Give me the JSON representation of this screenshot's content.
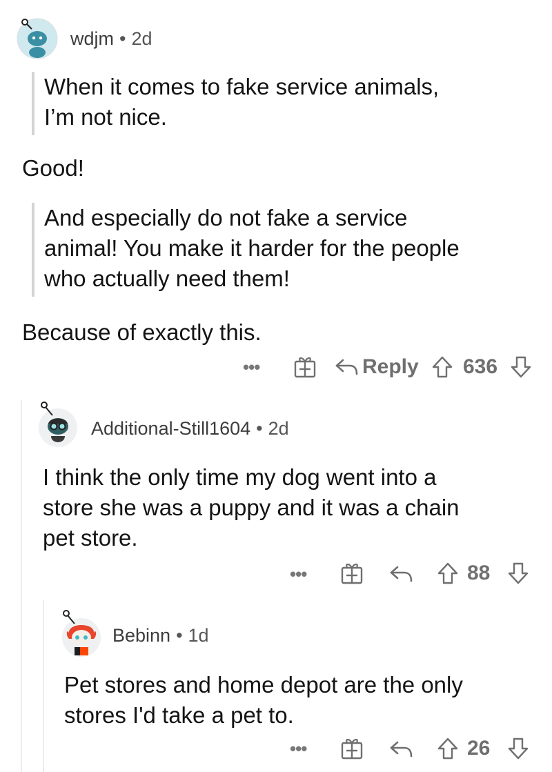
{
  "comments": [
    {
      "username": "wdjm",
      "separator": "•",
      "age": "2d",
      "quote1": [
        "When it comes to fake service animals,",
        "I’m not nice."
      ],
      "reply1": "Good!",
      "quote2": [
        "And especially do not fake a service",
        "animal! You make it harder for the people",
        "who actually need them!"
      ],
      "reply2": "Because of exactly this.",
      "more_label": "•••",
      "reply_label": "Reply",
      "score": "636"
    },
    {
      "username": "Additional-Still1604",
      "separator": "•",
      "age": "2d",
      "body": [
        "I think the only time my dog went into a",
        "store she was a puppy and it was a chain",
        "pet store."
      ],
      "more_label": "•••",
      "score": "88"
    },
    {
      "username": "Bebinn",
      "separator": "•",
      "age": "1d",
      "body": [
        "Pet stores and home depot are the only",
        "stores I'd take a pet to."
      ],
      "more_label": "•••",
      "score": "26"
    }
  ],
  "icons": {
    "award": "gift-award-icon",
    "reply": "reply-arrow-icon",
    "upvote": "upvote-arrow-icon",
    "downvote": "downvote-arrow-icon"
  },
  "colors": {
    "avatar_teal": "#3fb7c3",
    "accent_orange": "#ff4500",
    "meta_gray": "#555555"
  }
}
